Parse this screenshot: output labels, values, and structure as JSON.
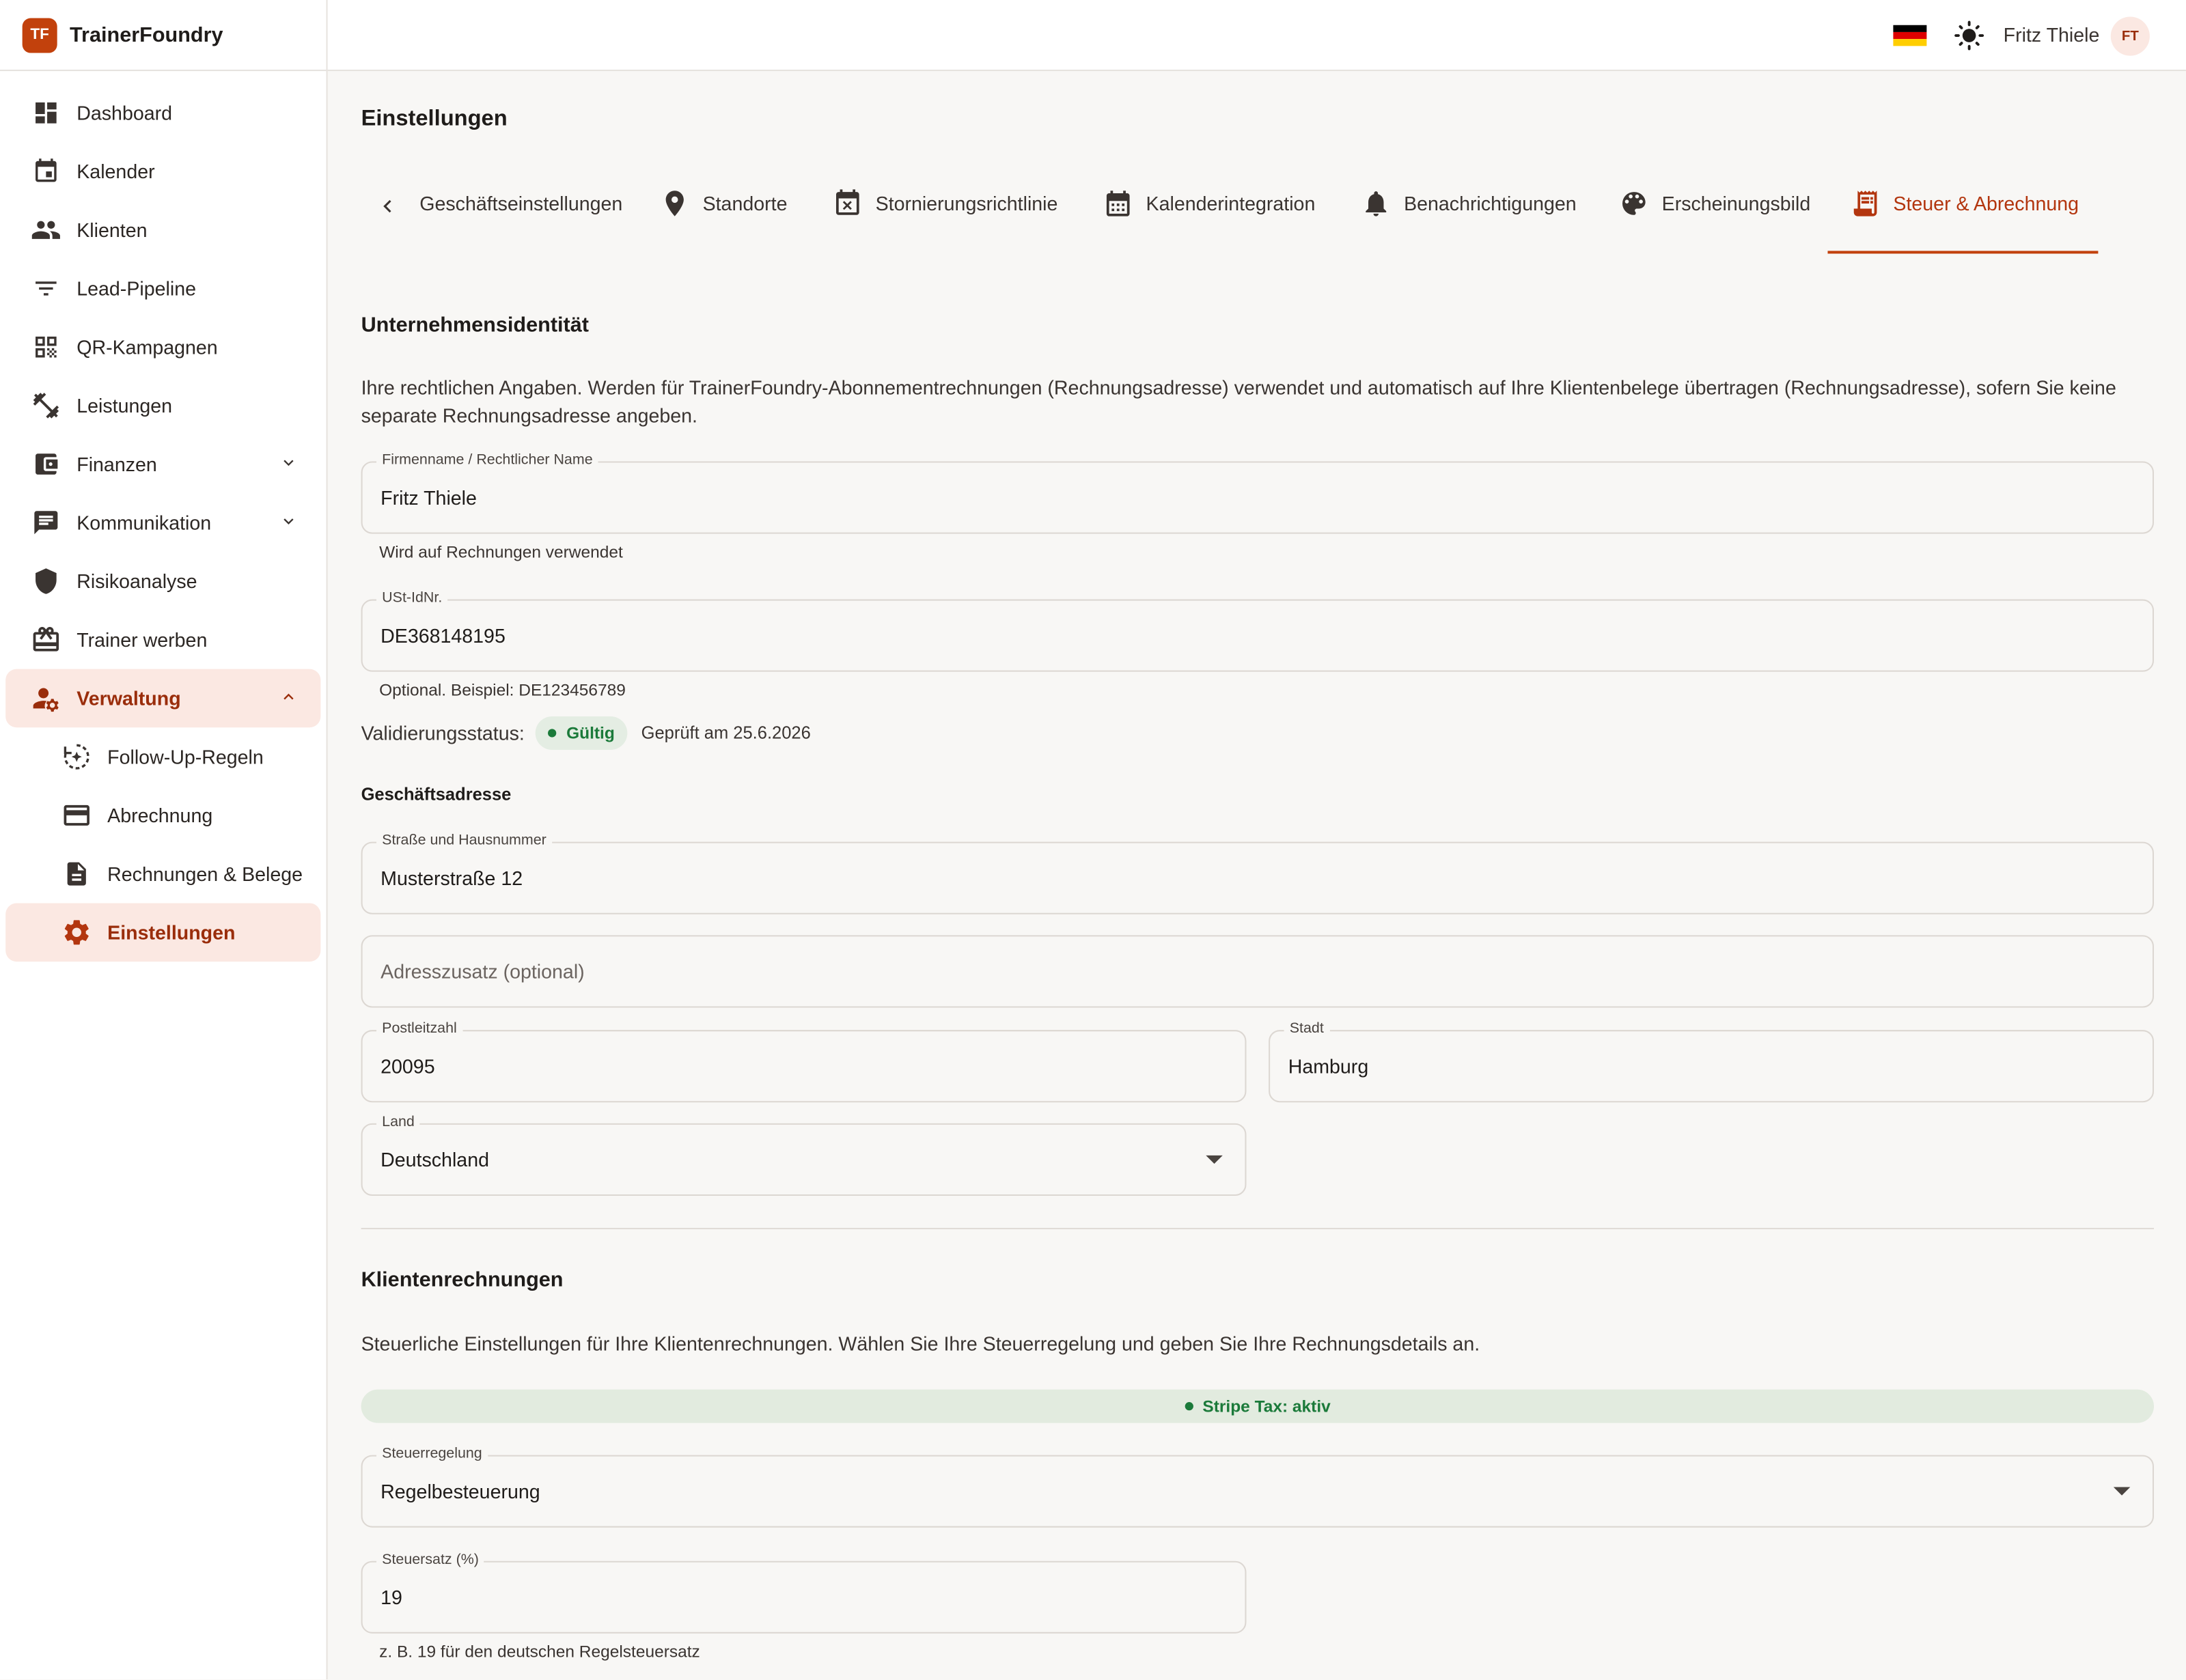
{
  "brand": {
    "logo_text": "TF",
    "name": "TrainerFoundry"
  },
  "sidebar": {
    "items": [
      {
        "label": "Dashboard",
        "icon": "dashboard-icon"
      },
      {
        "label": "Kalender",
        "icon": "calendar-icon"
      },
      {
        "label": "Klienten",
        "icon": "people-icon"
      },
      {
        "label": "Lead-Pipeline",
        "icon": "filter-icon"
      },
      {
        "label": "QR-Kampagnen",
        "icon": "qr-code-icon"
      },
      {
        "label": "Leistungen",
        "icon": "dumbbell-icon"
      },
      {
        "label": "Finanzen",
        "icon": "wallet-icon"
      },
      {
        "label": "Kommunikation",
        "icon": "chat-icon"
      },
      {
        "label": "Risikoanalyse",
        "icon": "shield-icon"
      },
      {
        "label": "Trainer werben",
        "icon": "gift-card-icon"
      },
      {
        "label": "Verwaltung",
        "icon": "manage-accounts-icon"
      }
    ],
    "sub_items": [
      {
        "label": "Follow-Up-Regeln",
        "icon": "follow-up-icon"
      },
      {
        "label": "Abrechnung",
        "icon": "credit-card-icon"
      },
      {
        "label": "Rechnungen & Belege",
        "icon": "document-icon"
      },
      {
        "label": "Einstellungen",
        "icon": "gear-icon"
      }
    ]
  },
  "topbar": {
    "user_name": "Fritz Thiele",
    "avatar_initials": "FT",
    "language_icon": "german-flag-icon",
    "theme_icon": "sun-icon"
  },
  "page": {
    "title": "Einstellungen"
  },
  "tabs": [
    {
      "label": "Geschäftseinstellungen",
      "icon": ""
    },
    {
      "label": "Standorte",
      "icon": "location-pin-icon"
    },
    {
      "label": "Stornierungsrichtlinie",
      "icon": "calendar-cancel-icon"
    },
    {
      "label": "Kalenderintegration",
      "icon": "calendar-month-icon"
    },
    {
      "label": "Benachrichtigungen",
      "icon": "bell-icon"
    },
    {
      "label": "Erscheinungsbild",
      "icon": "palette-icon"
    },
    {
      "label": "Steuer & Abrechnung",
      "icon": "receipt-icon"
    }
  ],
  "identity": {
    "heading": "Unternehmensidentität",
    "description": "Ihre rechtlichen Angaben. Werden für TrainerFoundry-Abonnementrechnungen (Rechnungsadresse) verwendet und automatisch auf Ihre Klientenbelege übertragen (Rechnungsadresse), sofern Sie keine separate Rechnungsadresse angeben.",
    "company_name": {
      "label": "Firmenname / Rechtlicher Name",
      "value": "Fritz Thiele",
      "helper": "Wird auf Rechnungen verwendet"
    },
    "vat_id": {
      "label": "USt-IdNr.",
      "value": "DE368148195",
      "helper": "Optional. Beispiel: DE123456789"
    },
    "validation": {
      "label": "Validierungsstatus:",
      "status": "Gültig",
      "checked": "Geprüft am 25.6.2026"
    }
  },
  "address": {
    "heading": "Geschäftsadresse",
    "street": {
      "label": "Straße und Hausnummer",
      "value": "Musterstraße 12"
    },
    "addition": {
      "placeholder": "Adresszusatz (optional)"
    },
    "zip": {
      "label": "Postleitzahl",
      "value": "20095"
    },
    "city": {
      "label": "Stadt",
      "value": "Hamburg"
    },
    "country": {
      "label": "Land",
      "value": "Deutschland"
    }
  },
  "client_invoices": {
    "heading": "Klientenrechnungen",
    "description": "Steuerliche Einstellungen für Ihre Klientenrechnungen. Wählen Sie Ihre Steuerregelung und geben Sie Ihre Rechnungsdetails an.",
    "stripe_status": "Stripe Tax: aktiv",
    "tax_regime": {
      "label": "Steuerregelung",
      "value": "Regelbesteuerung"
    },
    "tax_rate": {
      "label": "Steuersatz (%)",
      "value": "19",
      "helper": "z. B. 19 für den deutschen Regelsteuersatz"
    }
  },
  "colors": {
    "accent": "#c2410c",
    "active_bg": "#fbe8e2",
    "success": "#1b7a3a"
  }
}
